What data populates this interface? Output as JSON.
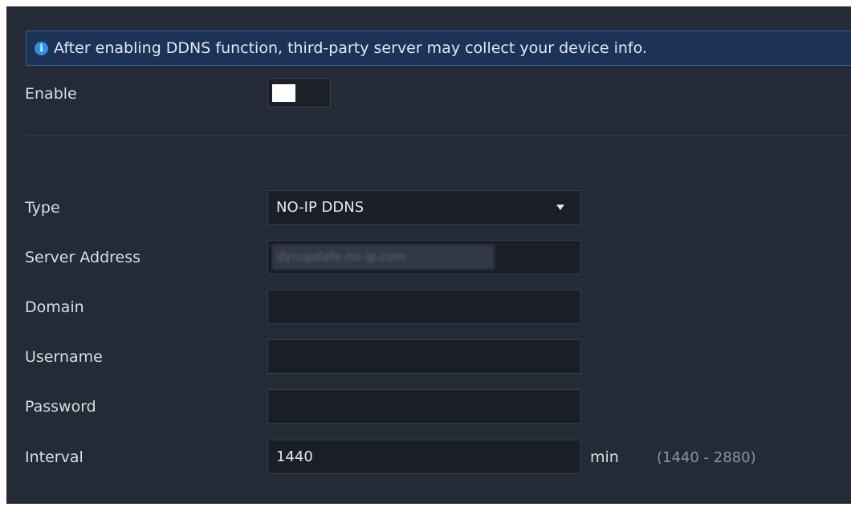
{
  "notice": {
    "icon": "info-icon",
    "text": "After enabling DDNS function, third-party server may collect your device info."
  },
  "enable": {
    "label": "Enable",
    "toggle_on": false
  },
  "form": {
    "type_label": "Type",
    "type_value": "NO-IP DDNS",
    "server_label": "Server Address",
    "server_value": "dynupdate.no-ip.com",
    "domain_label": "Domain",
    "domain_value": "",
    "username_label": "Username",
    "username_value": "",
    "password_label": "Password",
    "password_value": "",
    "interval_label": "Interval",
    "interval_value": "1440",
    "interval_unit": "min",
    "interval_range": "(1440 - 2880)"
  },
  "colors": {
    "panel_bg": "#252a37",
    "notice_bg": "#1c3357",
    "info_icon": "#2f8fe6",
    "field_bg": "#1a1e27"
  }
}
